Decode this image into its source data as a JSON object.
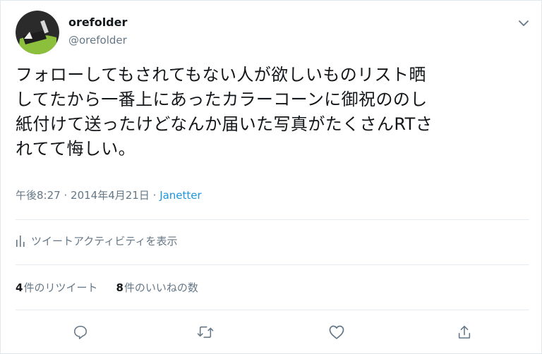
{
  "user": {
    "display_name": "orefolder",
    "handle": "@orefolder",
    "avatar_icon": "broom-cone-avatar-icon"
  },
  "tweet": {
    "lines": [
      "フォローしてもされてもない人が欲しいものリスト晒",
      "してたから一番上にあったカラーコーンに御祝ののし",
      "紙付けて送ったけどなんか届いた写真がたくさんRTさ",
      "れてて悔しい。"
    ]
  },
  "meta": {
    "time": "午後8:27",
    "separator1": "·",
    "date": "2014年4月21日",
    "separator2": "·",
    "source": "Janetter"
  },
  "activity": {
    "label": "ツイートアクティビティを表示",
    "icon": "bar-chart-icon"
  },
  "stats": {
    "retweets_count": "4",
    "retweets_label": "件のリツイート",
    "likes_count": "8",
    "likes_label": "件のいいねの数"
  },
  "actions": {
    "icons": [
      "reply-icon",
      "retweet-icon",
      "like-icon",
      "share-icon"
    ]
  },
  "colors": {
    "link": "#1b95e0",
    "secondary_text": "#657786",
    "primary_text": "#14171a",
    "avatar_green": "#8bbf3c",
    "avatar_dark": "#2b2b2b"
  }
}
